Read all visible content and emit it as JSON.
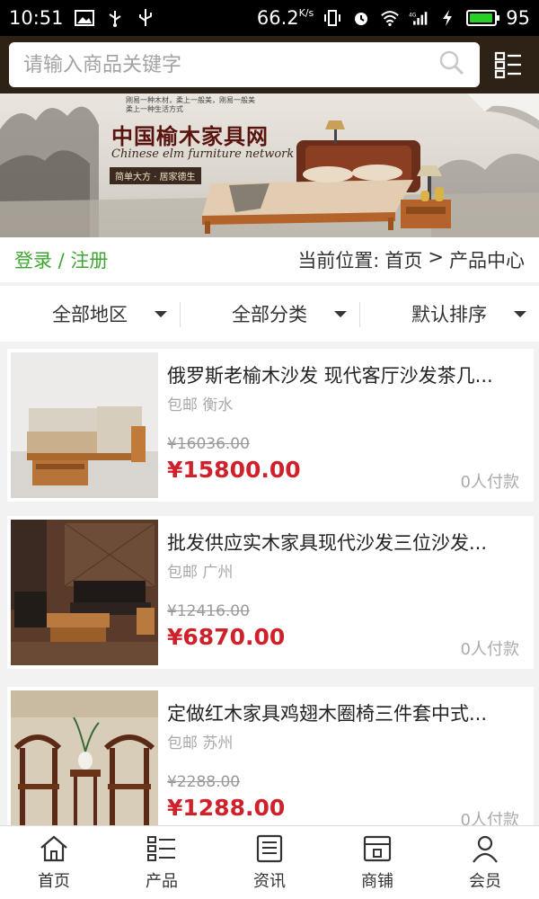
{
  "status_bar": {
    "time": "10:51",
    "speed": "66.2",
    "speed_unit": "K/s",
    "battery_level": "95",
    "battery_fraction": 0.95,
    "icons": [
      "image-icon",
      "usb-icon",
      "vibrate-icon",
      "alarm-icon",
      "wifi-icon",
      "signal-4g-icon",
      "charging-icon",
      "battery-icon"
    ]
  },
  "search": {
    "placeholder": "请输入商品关键字"
  },
  "banner": {
    "title_cn": "中国榆木家具网",
    "title_en": "Chinese elm furniture network",
    "slogan": "简单大方 · 居家德生",
    "poem_line1": "刚易一种木材，柔上一般美，刚易一般美",
    "poem_line2": "柔上一种生活方式"
  },
  "breadcrumb": {
    "login": "登录 / 注册",
    "label": "当前位置:",
    "home": "首页",
    "separator": ">",
    "current": "产品中心"
  },
  "filters": [
    {
      "label": "全部地区"
    },
    {
      "label": "全部分类"
    },
    {
      "label": "默认排序"
    }
  ],
  "products": [
    {
      "title": "俄罗斯老榆木沙发 现代客厅沙发茶几...",
      "meta": "包邮 衡水",
      "old_price": "¥16036.00",
      "price": "¥15800.00",
      "sales": "0人付款"
    },
    {
      "title": "批发供应实木家具现代沙发三位沙发...",
      "meta": "包邮 广州",
      "old_price": "¥12416.00",
      "price": "¥6870.00",
      "sales": "0人付款"
    },
    {
      "title": "定做红木家具鸡翅木圈椅三件套中式...",
      "meta": "包邮 苏州",
      "old_price": "¥2288.00",
      "price": "¥1288.00",
      "sales": "0人付款"
    }
  ],
  "bottom_nav": [
    {
      "label": "首页",
      "icon": "home-icon"
    },
    {
      "label": "产品",
      "icon": "list-icon"
    },
    {
      "label": "资讯",
      "icon": "news-icon"
    },
    {
      "label": "商铺",
      "icon": "shop-icon"
    },
    {
      "label": "会员",
      "icon": "user-icon"
    }
  ],
  "colors": {
    "header_bg": "#2e2216",
    "accent_green": "#3fa632",
    "price_red": "#d0202a"
  }
}
